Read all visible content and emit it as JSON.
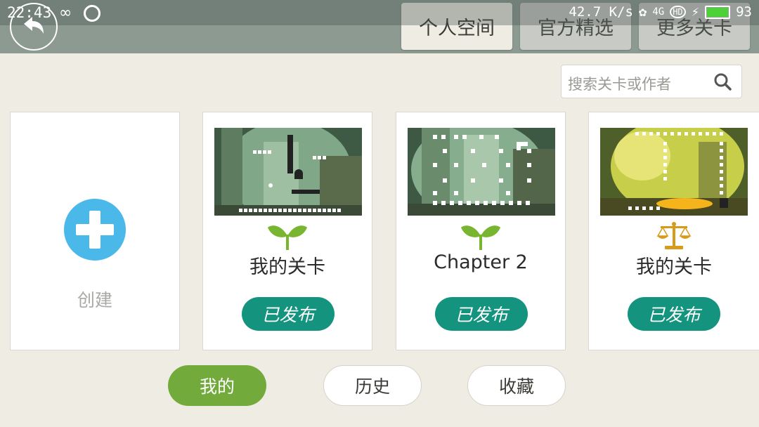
{
  "status_bar": {
    "time": "22:43",
    "icons_left": [
      "infinity-icon",
      "status-app-icon"
    ],
    "net_speed": "42.7 K/s",
    "signal_label": "4G",
    "battery_level": 93,
    "battery_text": "93"
  },
  "header": {
    "tabs": [
      {
        "label": "个人空间",
        "active": true
      },
      {
        "label": "官方精选",
        "active": false
      },
      {
        "label": "更多关卡",
        "active": false
      }
    ]
  },
  "search": {
    "placeholder": "搜索关卡或作者"
  },
  "create_card": {
    "label": "创建"
  },
  "levels": [
    {
      "title": "我的关卡",
      "icon": "sprout-icon",
      "button": "已发布"
    },
    {
      "title": "Chapter 2",
      "icon": "sprout-icon",
      "button": "已发布"
    },
    {
      "title": "我的关卡",
      "icon": "scales-icon",
      "button": "已发布"
    }
  ],
  "bottom_tabs": [
    {
      "label": "我的",
      "active": true
    },
    {
      "label": "历史",
      "active": false
    },
    {
      "label": "收藏",
      "active": false
    }
  ],
  "colors": {
    "background": "#efece3",
    "accent_green": "#72ab3c",
    "publish_teal": "#14937f",
    "create_blue": "#4bb8ea",
    "sprout_green": "#78b530",
    "scales_gold": "#d89a1a"
  }
}
